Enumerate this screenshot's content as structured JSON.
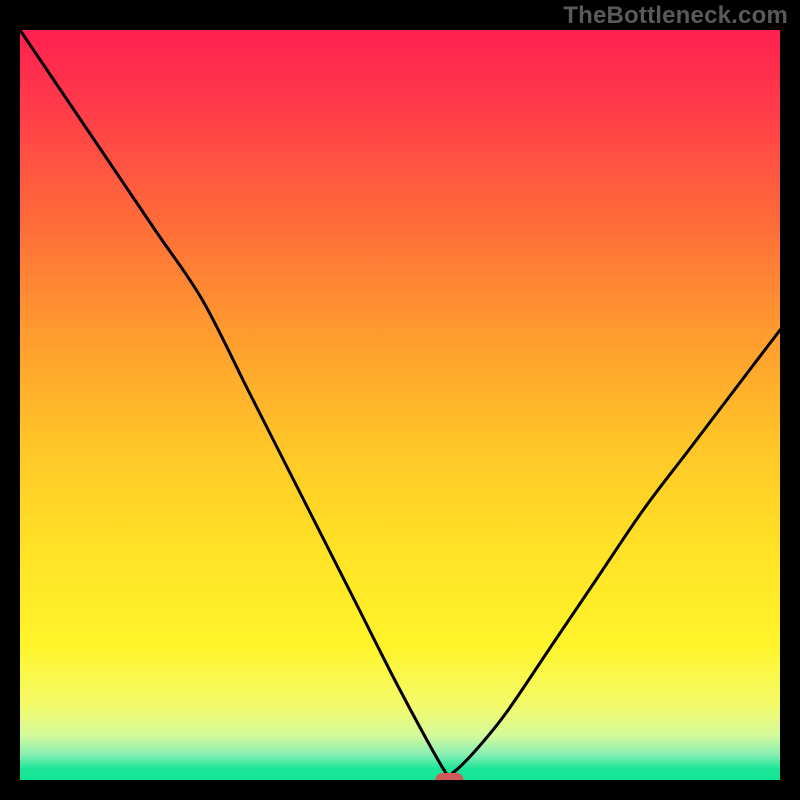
{
  "watermark": "TheBottleneck.com",
  "chart_data": {
    "type": "line",
    "title": "",
    "xlabel": "",
    "ylabel": "",
    "xlim": [
      0,
      100
    ],
    "ylim": [
      0,
      100
    ],
    "grid": false,
    "legend": false,
    "background": "gradient red-yellow-green",
    "series": [
      {
        "name": "bottleneck-curve",
        "x": [
          0,
          6,
          12,
          18,
          24,
          30,
          34,
          38,
          44,
          50,
          56,
          57,
          60,
          64,
          70,
          76,
          82,
          88,
          94,
          100
        ],
        "y": [
          100,
          91,
          82,
          73,
          64,
          52,
          44,
          36,
          24,
          12,
          1,
          1,
          4,
          9,
          18,
          27,
          36,
          44,
          52,
          60
        ],
        "color": "#000000",
        "marker": {
          "x": 56.5,
          "y": 0.0,
          "color": "#d05a5a",
          "shape": "rounded-rect"
        }
      }
    ]
  },
  "colors": {
    "frame": "#000000",
    "gradient_stops": [
      {
        "offset": 0.0,
        "color": "#ff2050"
      },
      {
        "offset": 0.1,
        "color": "#ff3a4a"
      },
      {
        "offset": 0.25,
        "color": "#ff6a3a"
      },
      {
        "offset": 0.4,
        "color": "#ff9a2f"
      },
      {
        "offset": 0.55,
        "color": "#ffc528"
      },
      {
        "offset": 0.7,
        "color": "#ffe326"
      },
      {
        "offset": 0.82,
        "color": "#fff42a"
      },
      {
        "offset": 0.9,
        "color": "#f4fb6a"
      },
      {
        "offset": 0.94,
        "color": "#d5fa9a"
      },
      {
        "offset": 0.965,
        "color": "#8cf0b4"
      },
      {
        "offset": 0.985,
        "color": "#1de59a"
      },
      {
        "offset": 1.0,
        "color": "#14e595"
      }
    ]
  }
}
